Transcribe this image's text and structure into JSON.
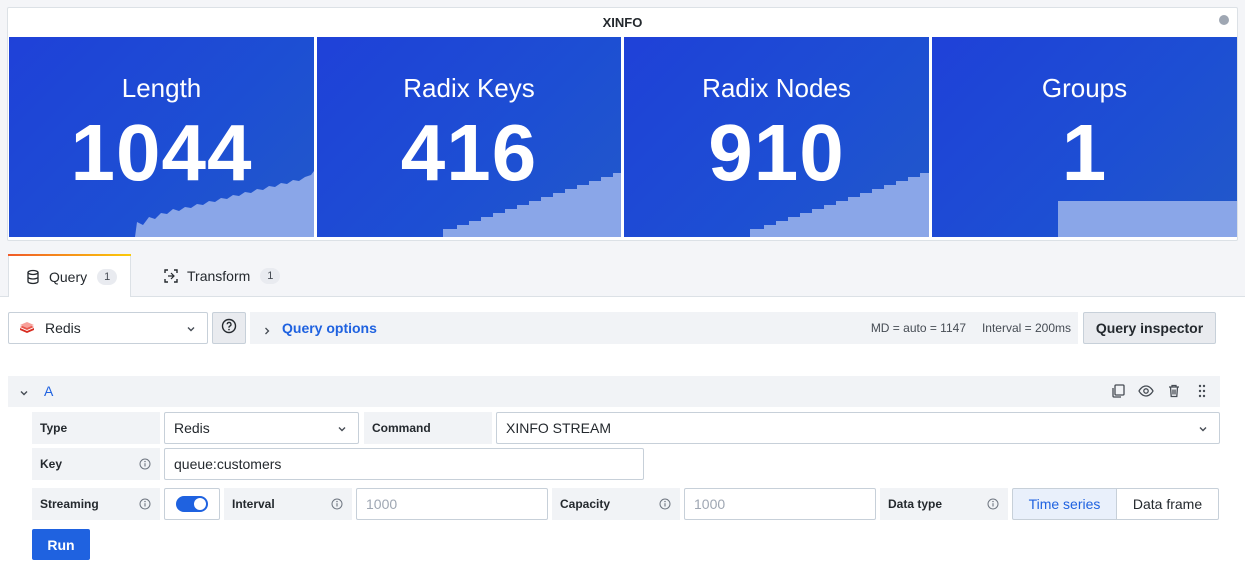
{
  "panel": {
    "title": "XINFO",
    "stats": [
      {
        "label": "Length",
        "value": "1044"
      },
      {
        "label": "Radix Keys",
        "value": "416"
      },
      {
        "label": "Radix Nodes",
        "value": "910"
      },
      {
        "label": "Groups",
        "value": "1"
      }
    ]
  },
  "tabs": [
    {
      "label": "Query",
      "count": "1",
      "icon": "database-icon"
    },
    {
      "label": "Transform",
      "count": "1",
      "icon": "transform-icon"
    }
  ],
  "toolbar": {
    "datasource": "Redis",
    "query_options_label": "Query options",
    "md_text": "MD = auto = 1147",
    "interval_text": "Interval = 200ms",
    "inspector_label": "Query inspector"
  },
  "query": {
    "ref_id": "A",
    "type_label": "Type",
    "type_value": "Redis",
    "command_label": "Command",
    "command_value": "XINFO STREAM",
    "key_label": "Key",
    "key_value": "queue:customers",
    "streaming_label": "Streaming",
    "streaming_on": true,
    "interval_label": "Interval",
    "interval_placeholder": "1000",
    "capacity_label": "Capacity",
    "capacity_placeholder": "1000",
    "datatype_label": "Data type",
    "datatype_options": [
      "Time series",
      "Data frame"
    ],
    "datatype_selected": "Time series",
    "run_label": "Run"
  },
  "colors": {
    "stat_bg": "#1f41d8",
    "accent": "#1f62e0",
    "spark_fill": "#8aa6e8"
  }
}
